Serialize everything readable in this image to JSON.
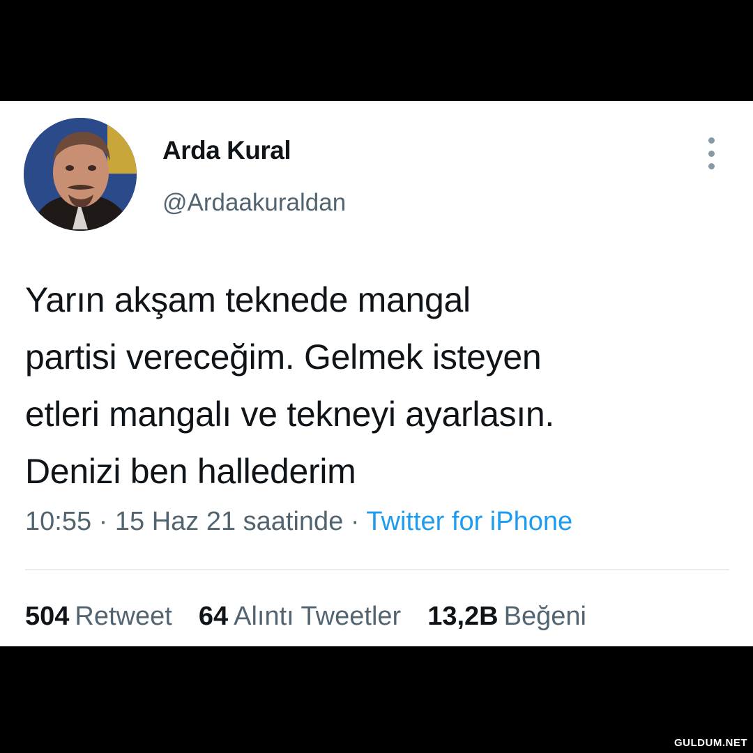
{
  "user": {
    "display_name": "Arda Kural",
    "handle": "@Ardaakuraldan"
  },
  "tweet": {
    "lines": [
      "Yarın akşam teknede mangal",
      "partisi vereceğim. Gelmek isteyen",
      "etleri mangalı ve tekneyi ayarlasın.",
      "Denizi ben hallederim"
    ],
    "time": "10:55",
    "separator": " · ",
    "date": "15 Haz 21 saatinde",
    "source": "Twitter for iPhone"
  },
  "stats": {
    "retweets_count": "504",
    "retweets_label": "Retweet",
    "quotes_count": "64",
    "quotes_label": "Alıntı Tweetler",
    "likes_count": "13,2B",
    "likes_label": "Beğeni"
  },
  "icons": {
    "more": "more-vertical-icon"
  },
  "colors": {
    "text": "#0f1419",
    "secondary": "#536471",
    "link": "#1d9bf0",
    "frame": "#000000"
  },
  "watermark": "GULDUM.NET"
}
